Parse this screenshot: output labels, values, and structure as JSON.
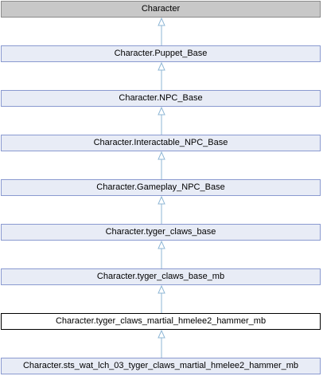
{
  "diagram": {
    "type": "inheritance-graph",
    "nodes": [
      {
        "label": "Character",
        "kind": "root"
      },
      {
        "label": "Character.Puppet_Base",
        "kind": "base"
      },
      {
        "label": "Character.NPC_Base",
        "kind": "base"
      },
      {
        "label": "Character.Interactable_NPC_Base",
        "kind": "base"
      },
      {
        "label": "Character.Gameplay_NPC_Base",
        "kind": "base"
      },
      {
        "label": "Character.tyger_claws_base",
        "kind": "base"
      },
      {
        "label": "Character.tyger_claws_base_mb",
        "kind": "base"
      },
      {
        "label": "Character.tyger_claws_martial_hmelee2_hammer_mb",
        "kind": "current"
      },
      {
        "label": "Character.sts_wat_lch_03_tyger_claws_martial_hmelee2_hammer_mb",
        "kind": "derived"
      }
    ],
    "colors": {
      "node_fill": "#e8ecf6",
      "node_border": "#8a9ad0",
      "root_fill": "#c8c8c8",
      "current_fill": "#ffffff",
      "current_border": "#000000",
      "edge": "#8fb7d6"
    }
  }
}
